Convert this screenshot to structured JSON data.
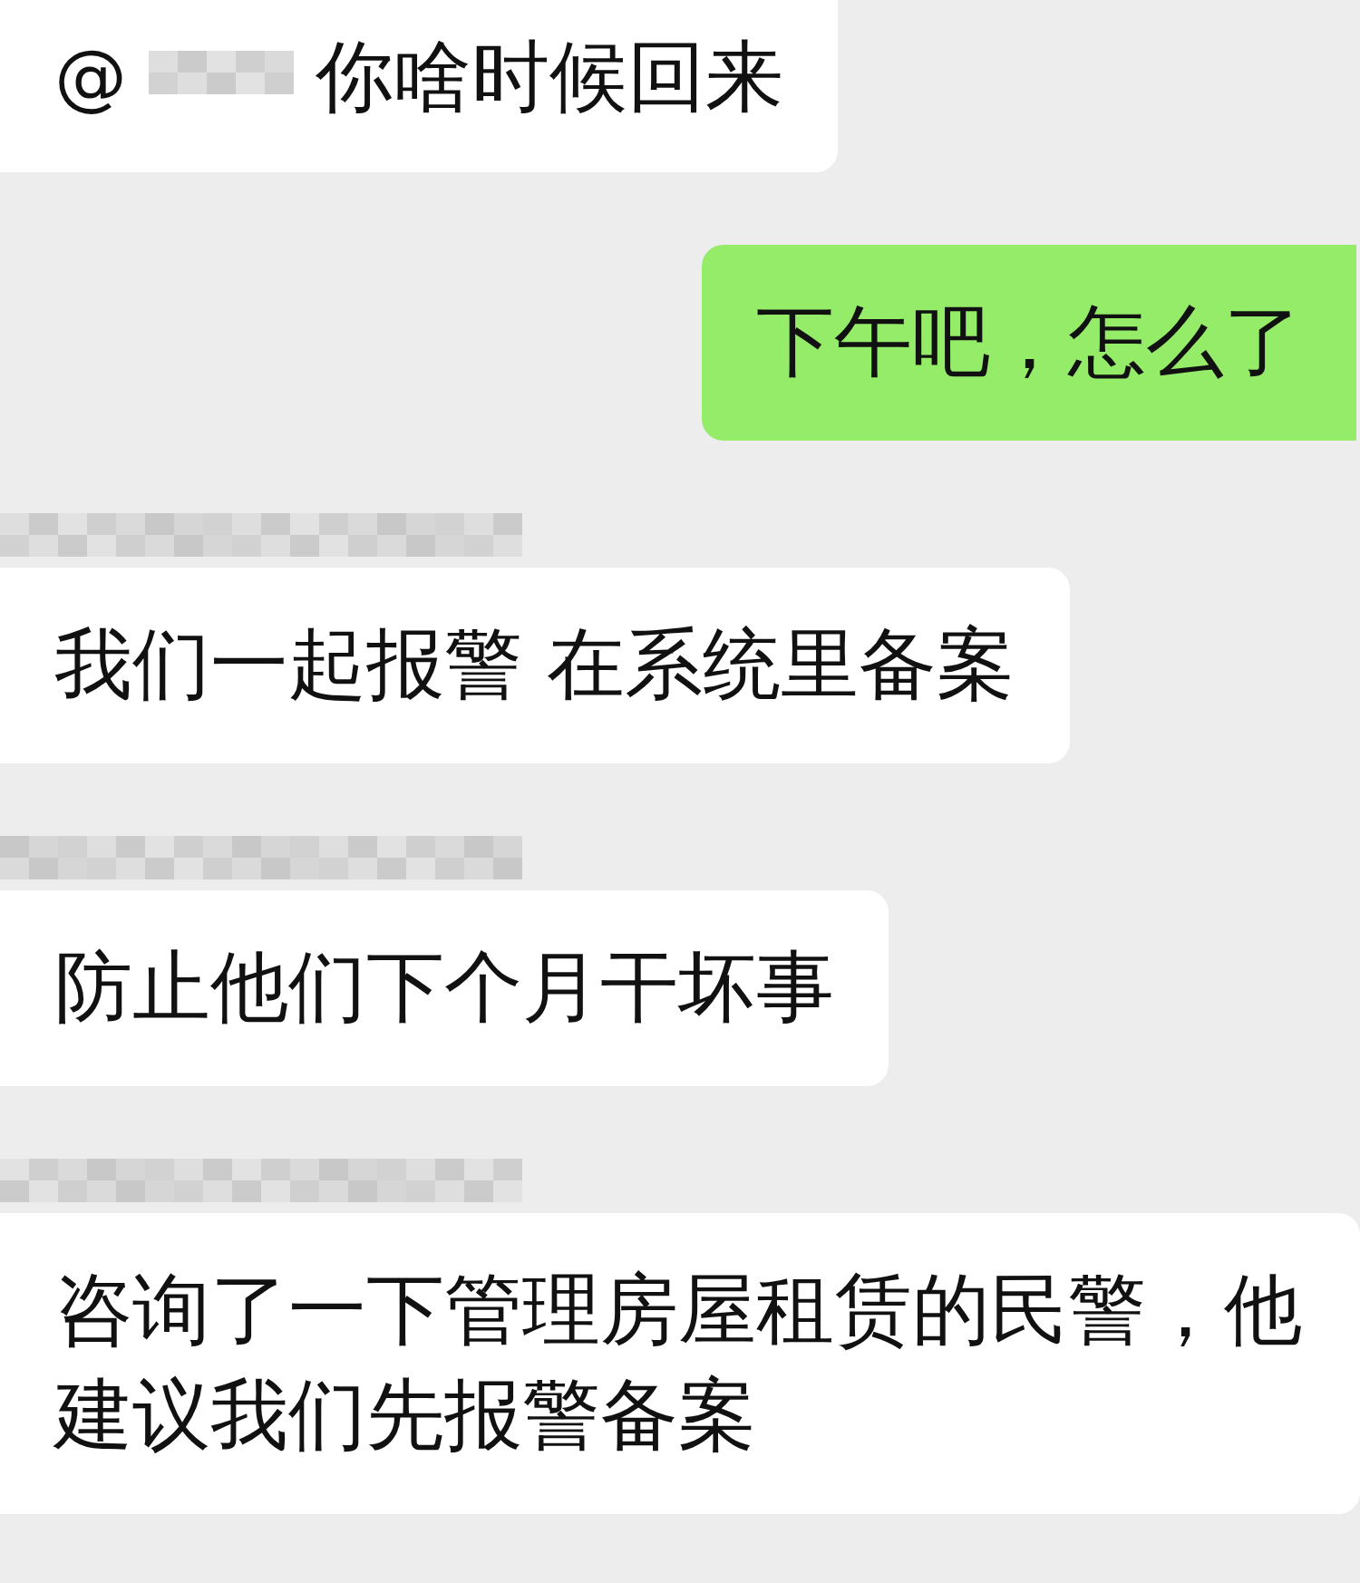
{
  "messages": [
    {
      "kind": "incoming",
      "sender_blurred": false,
      "mention": "@",
      "text": "你啥时候回来"
    },
    {
      "kind": "outgoing",
      "sender_blurred": false,
      "text": "下午吧，怎么了"
    },
    {
      "kind": "incoming",
      "sender_blurred": true,
      "text": "我们一起报警 在系统里备案"
    },
    {
      "kind": "incoming",
      "sender_blurred": true,
      "text": "防止他们下个月干坏事"
    },
    {
      "kind": "incoming",
      "sender_blurred": true,
      "text": "咨询了一下管理房屋租赁的民警，他建议我们先报警备案"
    }
  ]
}
